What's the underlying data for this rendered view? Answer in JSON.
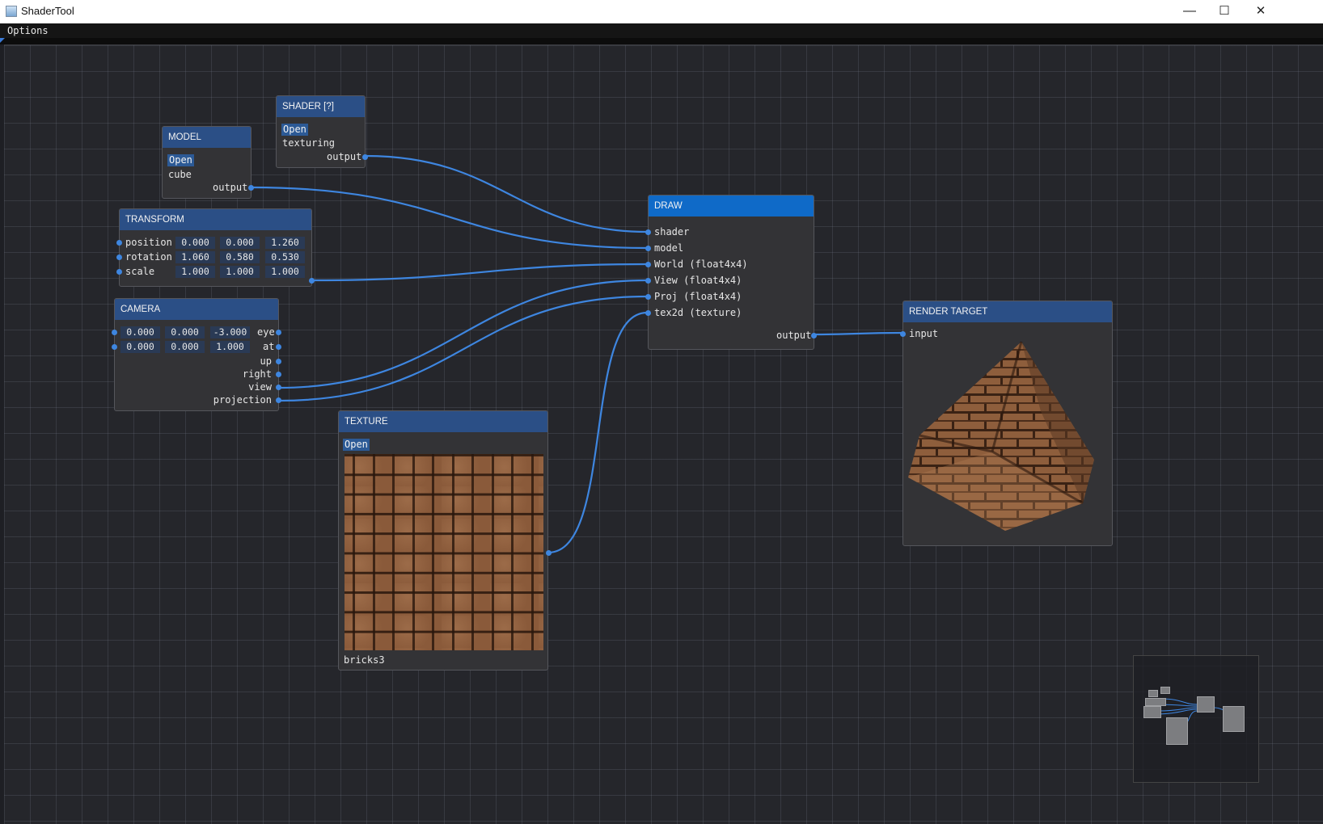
{
  "window": {
    "title": "ShaderTool",
    "minimize": "—",
    "maximize": "☐",
    "close": "✕"
  },
  "menu": {
    "options": "Options"
  },
  "colors": {
    "link": "#3e86e0",
    "header": "#2b4f86",
    "active_header": "#0f6ac8",
    "background": "#25262b"
  },
  "nodes": {
    "shader": {
      "title": "SHADER [?]",
      "open": "Open",
      "file": "texturing",
      "output": "output"
    },
    "model": {
      "title": "MODEL",
      "open": "Open",
      "file": "cube",
      "output": "output"
    },
    "transform": {
      "title": "TRANSFORM",
      "rows": [
        {
          "label": "position",
          "values": [
            "0.000",
            "0.000",
            "1.260"
          ]
        },
        {
          "label": "rotation",
          "values": [
            "1.060",
            "0.580",
            "0.530"
          ]
        },
        {
          "label": "scale",
          "values": [
            "1.000",
            "1.000",
            "1.000"
          ]
        }
      ]
    },
    "camera": {
      "title": "CAMERA",
      "eye": {
        "label": "eye",
        "values": [
          "0.000",
          "0.000",
          "-3.000"
        ]
      },
      "at": {
        "label": "at",
        "values": [
          "0.000",
          "0.000",
          "1.000"
        ]
      },
      "outputs": [
        "up",
        "right",
        "view",
        "projection"
      ]
    },
    "draw": {
      "title": "DRAW",
      "inputs": [
        "shader",
        "model",
        "World (float4x4)",
        "View (float4x4)",
        "Proj (float4x4)",
        "tex2d (texture)"
      ],
      "output": "output"
    },
    "render_target": {
      "title": "RENDER TARGET",
      "input": "input"
    },
    "texture": {
      "title": "TEXTURE",
      "open": "Open",
      "name": "bricks3"
    }
  }
}
